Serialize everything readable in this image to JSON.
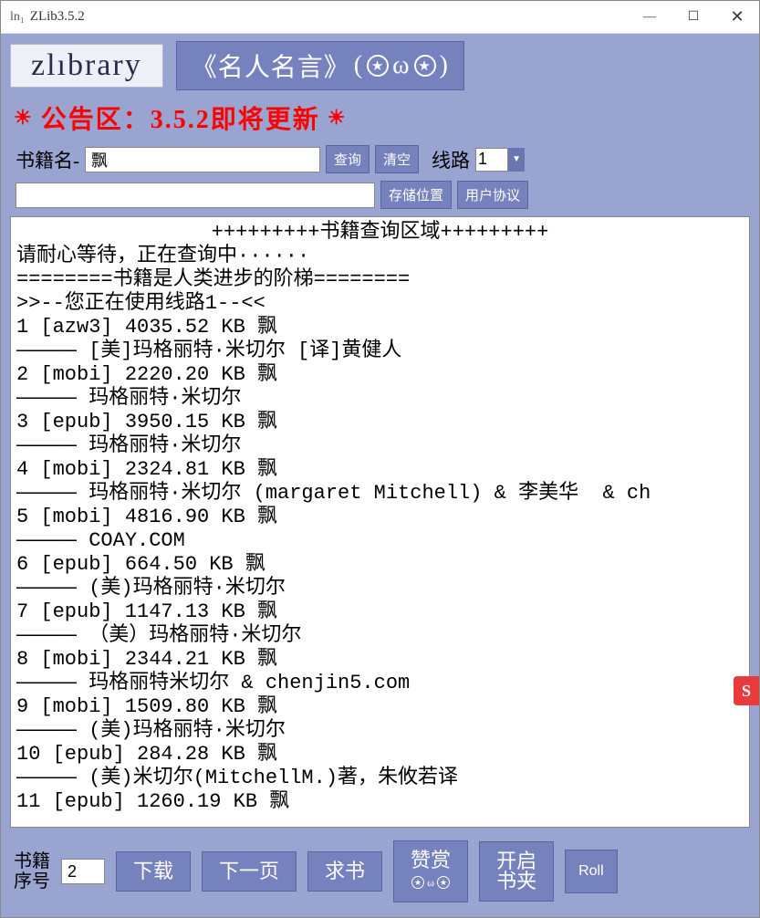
{
  "titlebar": {
    "title": "ZLib3.5.2"
  },
  "header": {
    "logo": "zlıbrary",
    "quote_left": "《名人名言》"
  },
  "notice": "公告区：3.5.2即将更新",
  "search": {
    "label": "书籍名-",
    "value": "飘",
    "btn_query": "查询",
    "btn_clear": "清空",
    "line_label": "线路",
    "line_value": "1"
  },
  "path": {
    "value": "",
    "btn_save": "存储位置",
    "btn_agree": "用户协议"
  },
  "results": {
    "header": "+++++++++书籍查询区域+++++++++",
    "lines": [
      "请耐心等待，正在查询中······",
      "========书籍是人类进步的阶梯========",
      ">>--您正在使用线路1--<<",
      "1 [azw3] 4035.52 KB 飘",
      "————— [美]玛格丽特·米切尔 [译]黄健人",
      "2 [mobi] 2220.20 KB 飘",
      "————— 玛格丽特·米切尔",
      "3 [epub] 3950.15 KB 飘",
      "————— 玛格丽特·米切尔",
      "4 [mobi] 2324.81 KB 飘",
      "————— 玛格丽特·米切尔 (margaret Mitchell) & 李美华  & ch",
      "5 [mobi] 4816.90 KB 飘",
      "————— COAY.COM",
      "6 [epub] 664.50 KB 飘",
      "————— (美)玛格丽特·米切尔",
      "7 [epub] 1147.13 KB 飘",
      "————— （美）玛格丽特·米切尔",
      "8 [mobi] 2344.21 KB 飘",
      "————— 玛格丽特米切尔 & chenjin5.com",
      "9 [mobi] 1509.80 KB 飘",
      "————— (美)玛格丽特·米切尔",
      "10 [epub] 284.28 KB 飘",
      "————— (美)米切尔(MitchellM.)著，朱攸若译",
      "11 [epub] 1260.19 KB 飘"
    ]
  },
  "bottom": {
    "serial_label1": "书籍",
    "serial_label2": "序号",
    "serial_value": "2",
    "btn_download": "下载",
    "btn_next": "下一页",
    "btn_request": "求书",
    "btn_praise": "赞赏",
    "btn_open": "开启",
    "btn_folder": "书夹",
    "btn_roll": "Roll"
  },
  "badge": "S"
}
